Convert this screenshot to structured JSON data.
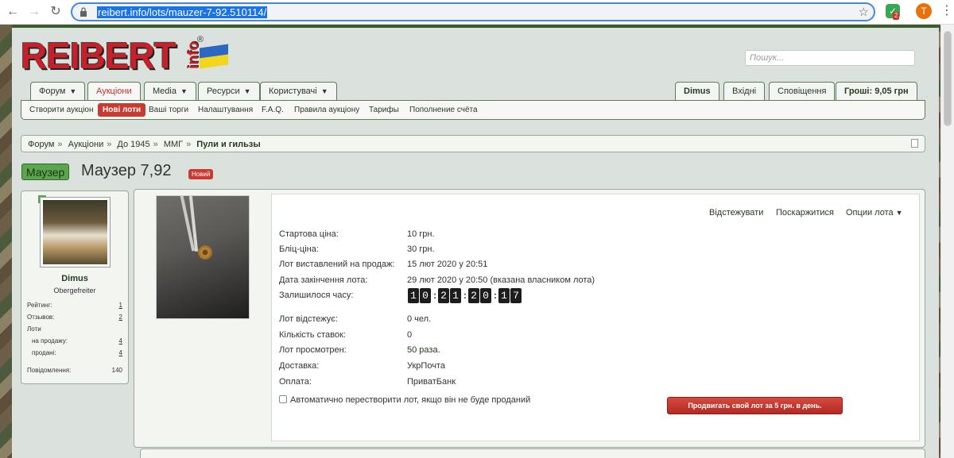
{
  "browser": {
    "url": "reibert.info/lots/mauzer-7-92.510114/",
    "extension_badge": "2",
    "profile_initial": "T"
  },
  "site": {
    "logo_text": "REIBERT",
    "logo_suffix": "info",
    "logo_reg": "®",
    "search_placeholder": "Пошук..."
  },
  "nav": {
    "tabs": [
      {
        "label": "Форум"
      },
      {
        "label": "Аукціони"
      },
      {
        "label": "Media"
      },
      {
        "label": "Ресурси"
      },
      {
        "label": "Користувачі"
      }
    ],
    "user_tabs": [
      {
        "label": "Dimus"
      },
      {
        "label": "Вхідні"
      },
      {
        "label": "Сповіщення"
      },
      {
        "label": "Гроші: 9,05 грн"
      }
    ],
    "subnav": [
      "Створити аукціон",
      "Нові лоти",
      "Ваші торги",
      "Налаштування",
      "F.A.Q.",
      "Правила аукціону",
      "Тарифы",
      "Пополнение счёта"
    ]
  },
  "breadcrumb": {
    "items": [
      "Форум",
      "Аукціони",
      "До 1945",
      "ММГ"
    ],
    "current": "Пули и гильзы"
  },
  "lot": {
    "prefix": "Маузер",
    "title": "Маузер 7,92",
    "badge": "Новий",
    "actions": [
      "Відстежувати",
      "Поскаржитися",
      "Опции лота"
    ],
    "fields": [
      {
        "label": "Стартова ціна:",
        "value": "10 грн."
      },
      {
        "label": "Бліц-ціна:",
        "value": "30 грн."
      },
      {
        "label": "Лот виставлений на продаж:",
        "value": "15 лют 2020 у 20:51"
      },
      {
        "label": "Дата закінчення лота:",
        "value": "29 лют 2020 у 20:50 (вказана власником лота)"
      },
      {
        "label": "Залишилося часу:",
        "value": ""
      },
      {
        "label": "Лот відстежує:",
        "value": "0 чел."
      },
      {
        "label": "Кількість ставок:",
        "value": "0"
      },
      {
        "label": "Лот просмотрен:",
        "value": "50 раза."
      },
      {
        "label": "Доставка:",
        "value": "УкрПочта"
      },
      {
        "label": "Оплата:",
        "value": "ПриватБанк"
      }
    ],
    "timer": [
      "1",
      "0",
      "2",
      "1",
      "2",
      "0",
      "1",
      "7"
    ],
    "auto_relist_label": "Автоматично перестворити лот, якщо він не буде проданий",
    "promote_button": "Продвигать свой лот за 5 грн. в день."
  },
  "seller": {
    "name": "Dimus",
    "rank": "Obergefreiter",
    "stats": [
      {
        "label": "Рейтинг:",
        "value": "1"
      },
      {
        "label": "Отзывов:",
        "value": "2"
      },
      {
        "label": "Лоти",
        "value": ""
      },
      {
        "label": "на продажу:",
        "value": "4"
      },
      {
        "label": "продані:",
        "value": "4"
      },
      {
        "label": "Повідомлення:",
        "value": "140"
      }
    ]
  }
}
